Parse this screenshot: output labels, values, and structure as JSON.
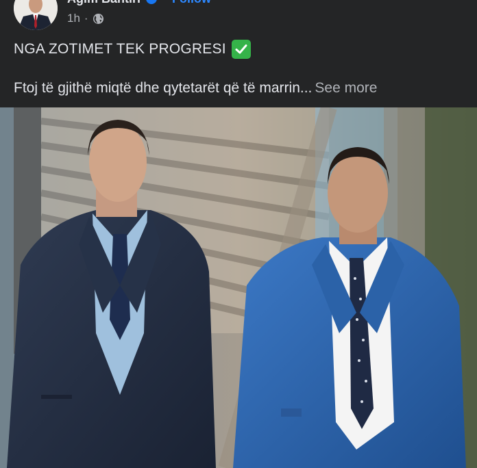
{
  "post": {
    "author": "Agim Bahtiri",
    "follow_label": "Follow",
    "timestamp": "1h",
    "meta_sep": "·",
    "headline": "NGA ZOTIMET TEK PROGRESI",
    "body_preview": "Ftoj të gjithë miqtë dhe qytetarët që të marrin...",
    "see_more_label": "See more",
    "icons": {
      "verified": "verified-badge-icon",
      "audience": "globe-icon",
      "emoji": "check-mark-emoji-icon"
    }
  },
  "colors": {
    "background": "#242526",
    "text": "#e4e6eb",
    "secondary_text": "#b0b3b8",
    "link": "#2d88ff",
    "check_green": "#35b349"
  }
}
